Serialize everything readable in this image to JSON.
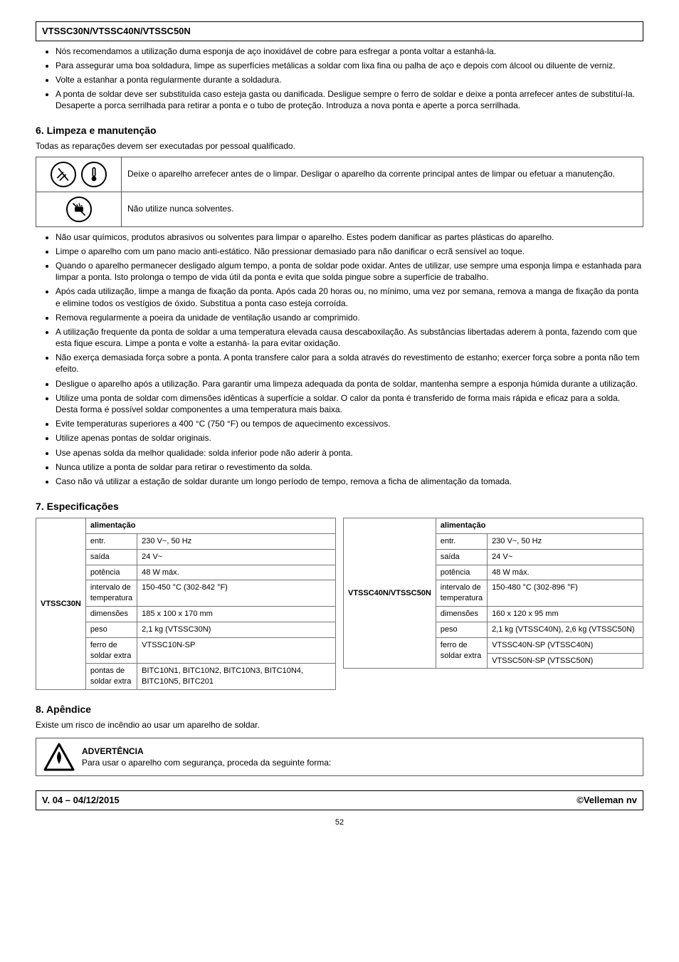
{
  "header": {
    "model": "VTSSC30N/VTSSC40N/VTSSC50N",
    "lang_right": ""
  },
  "top_list": [
    "Nós recomendamos a utilização duma esponja de aço inoxidável de cobre para esfregar a ponta voltar a estanhá-la.",
    "Para assegurar uma boa soldadura, limpe as superfícies metálicas a soldar com lixa fina ou palha de aço e depois com álcool ou diluente de verniz.",
    "Volte a estanhar a ponta regularmente durante a soldadura.",
    "A ponta de soldar deve ser substituída caso esteja gasta ou danificada. Desligue sempre o ferro de soldar e deixe a ponta arrefecer antes de substituí-la. Desaperte a porca serrilhada para retirar a ponta e o tubo de proteção. Introduza a nova ponta e aperte a porca serrilhada."
  ],
  "sec6": {
    "title": "6. Limpeza e manutenção",
    "sub": "Todas as reparações devem ser executadas por pessoal qualificado.",
    "warns": [
      {
        "icon_name": "unplug-temp-icon",
        "text": "Deixe o aparelho arrefecer antes de o limpar. Desligar o aparelho da corrente principal antes de limpar ou efetuar a manutenção."
      },
      {
        "icon_name": "no-solvent-icon",
        "text": "Não utilize nunca solventes."
      }
    ],
    "bullets": [
      "Não usar químicos, produtos abrasivos ou solventes para limpar o aparelho. Estes podem danificar as partes plásticas do aparelho.",
      "Limpe o aparelho com um pano macio anti-estático. Não pressionar demasiado para não danificar o ecrã sensível ao toque.",
      "Quando o aparelho permanecer desligado algum tempo, a ponta de soldar pode oxidar. Antes de utilizar, use sempre uma esponja limpa e estanhada para limpar a ponta. Isto prolonga o tempo de vida útil da ponta e evita que solda pingue sobre a superfície de trabalho.",
      "Após cada utilização, limpe a manga de fixação da ponta. Após cada 20 horas ou, no mínimo, uma vez por semana, remova a manga de fixação da ponta e elimine todos os vestígios de óxido. Substitua a ponta caso esteja corroída.",
      "Remova regularmente a poeira da unidade de ventilação usando ar comprimido.",
      "A utilização frequente da ponta de soldar a uma temperatura elevada causa descaboxilação. As substâncias libertadas aderem à ponta, fazendo com que esta fique escura. Limpe a ponta e volte a estanhá- la para evitar oxidação.",
      "Não exerça demasiada força sobre a ponta. A ponta transfere calor para a solda através do revestimento de estanho; exercer força sobre a ponta não tem efeito.",
      "Desligue o aparelho após a utilização. Para garantir uma limpeza adequada da ponta de soldar, mantenha sempre a esponja húmida durante a utilização.",
      "Utilize uma ponta de soldar com dimensões idênticas à superfície a soldar. O calor da ponta é transferido de forma mais rápida e eficaz para a solda. Desta forma é possível soldar componentes a uma temperatura mais baixa.",
      "Evite temperaturas superiores a 400 °C (750 °F) ou tempos de aquecimento excessivos.",
      "Utilize apenas pontas de soldar originais.",
      "Use apenas solda da melhor qualidade: solda inferior pode não aderir à ponta.",
      "Nunca utilize a ponta de soldar para retirar o revestimento da solda.",
      "Caso não vá utilizar a estação de soldar durante um longo período de tempo, remova a ficha de alimentação da tomada."
    ]
  },
  "sec7": {
    "title": "7. Especificações",
    "left": {
      "model": "VTSSC30N",
      "power_in": {
        "label": "alimentação",
        "rows": [
          {
            "k": "entr.",
            "v": "230 V~, 50 Hz"
          },
          {
            "k": "saída",
            "v": "24 V~"
          }
        ]
      },
      "power": {
        "label": "potência",
        "rows": [
          {
            "k": "",
            "v": "48 W máx."
          }
        ]
      },
      "temp_range": {
        "label": "intervalo de temperatura",
        "rows": [
          {
            "k": "",
            "v": "150-450 °C (302-842 °F)"
          }
        ]
      },
      "dims": {
        "label": "dimensões",
        "rows": [
          {
            "k": "",
            "v": "185 x 100 x 170 mm"
          }
        ]
      },
      "weight": {
        "label": "peso",
        "rows": [
          {
            "k": "",
            "v": "2,1 kg (VTSSC30N)"
          }
        ]
      },
      "spare_iron": {
        "label": "ferro de soldar extra",
        "rows": [
          {
            "k": "",
            "v": "VTSSC10N-SP"
          }
        ]
      },
      "spare_tips": {
        "label": "pontas de soldar extra",
        "rows": [
          {
            "k": "",
            "v": "BITC10N1, BITC10N2, BITC10N3, BITC10N4, BITC10N5, BITC201"
          }
        ]
      }
    },
    "right": {
      "models": "VTSSC40N/VTSSC50N",
      "power_in": {
        "label": "alimentação",
        "rows": [
          {
            "k": "entr.",
            "v": "230 V~, 50 Hz"
          },
          {
            "k": "saída",
            "v": "24 V~"
          }
        ]
      },
      "power": {
        "label": "potência",
        "rows": [
          {
            "k": "",
            "v": "48 W máx."
          }
        ]
      },
      "temp_range": {
        "label": "intervalo de temperatura",
        "rows": [
          {
            "k": "",
            "v": "150-480 °C (302-896 °F)"
          }
        ]
      },
      "dims": {
        "label": "dimensões",
        "rows": [
          {
            "k": "",
            "v": "160 x 120 x 95 mm"
          }
        ]
      },
      "weight": {
        "label": "peso",
        "rows": [
          {
            "k": "",
            "v": "2,1 kg (VTSSC40N), 2,6 kg (VTSSC50N)"
          }
        ]
      },
      "spare_iron": {
        "label": "ferro de soldar extra",
        "rows": [
          {
            "k": "",
            "v": "VTSSC40N-SP (VTSSC40N)"
          },
          {
            "k": "",
            "v": "VTSSC50N-SP (VTSSC50N)"
          }
        ]
      }
    }
  },
  "sec8": {
    "title": "8. Apêndice",
    "sub": "Existe um risco de incêndio ao usar um aparelho de soldar.",
    "warn_title": "ADVERTÊNCIA",
    "warn_sub": "Para usar o aparelho com segurança, proceda da seguinte forma:"
  },
  "footer": {
    "left": "V. 04 – 04/12/2015",
    "right": "©Velleman nv"
  },
  "page_no": "52"
}
